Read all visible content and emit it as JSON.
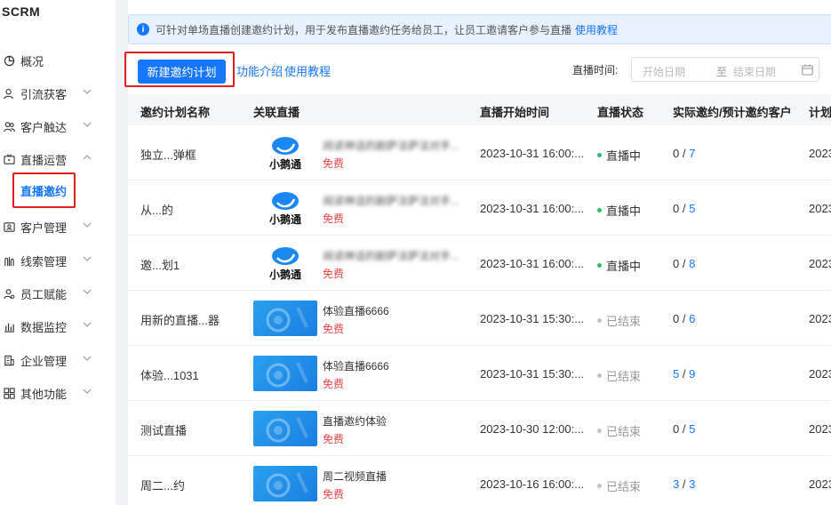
{
  "app": {
    "brand": "SCRM"
  },
  "sidebar": {
    "items": [
      {
        "label": "概况",
        "icon": "pie-chart-icon",
        "has_chevron": false
      },
      {
        "label": "引流获客",
        "icon": "user-add-icon",
        "has_chevron": true
      },
      {
        "label": "客户触达",
        "icon": "users-icon",
        "has_chevron": true
      },
      {
        "label": "直播运营",
        "icon": "tv-icon",
        "has_chevron": true,
        "expanded": true
      },
      {
        "label": "客户管理",
        "icon": "contact-card-icon",
        "has_chevron": true
      },
      {
        "label": "线索管理",
        "icon": "clue-icon",
        "has_chevron": true
      },
      {
        "label": "员工赋能",
        "icon": "staff-icon",
        "has_chevron": true
      },
      {
        "label": "数据监控",
        "icon": "bar-chart-icon",
        "has_chevron": true
      },
      {
        "label": "企业管理",
        "icon": "building-icon",
        "has_chevron": true
      },
      {
        "label": "其他功能",
        "icon": "grid-icon",
        "has_chevron": true
      }
    ],
    "active_sub": "直播邀约"
  },
  "notice": {
    "text": "可针对单场直播创建邀约计划，用于发布直播邀约任务给员工，让员工邀请客户参与直播",
    "link": "使用教程"
  },
  "toolbar": {
    "create_label": "新建邀约计划",
    "intro_label": "功能介绍",
    "tutorial_label": "使用教程",
    "time_label": "直播时间:",
    "start_placeholder": "开始日期",
    "range_sep": "至",
    "end_placeholder": "结束日期"
  },
  "table": {
    "columns": [
      "邀约计划名称",
      "关联直播",
      "直播开始时间",
      "直播状态",
      "实际邀约/预计邀约客户",
      "计划"
    ],
    "rows": [
      {
        "name": "独立...弹框",
        "live_title": "阅读神话的剧萨法萨法对手...",
        "live_thumb": "logo",
        "free": "免费",
        "start_time": "2023-10-31 16:00:...",
        "status": "直播中",
        "status_type": "live",
        "actual": "0",
        "expected": "7",
        "actual_blue": false,
        "plan": "2023"
      },
      {
        "name": "从...的",
        "live_title": "阅读神话的剧萨法萨法对手...",
        "live_thumb": "logo",
        "free": "免费",
        "start_time": "2023-10-31 16:00:...",
        "status": "直播中",
        "status_type": "live",
        "actual": "0",
        "expected": "5",
        "actual_blue": false,
        "plan": "2023"
      },
      {
        "name": "邀...划1",
        "live_title": "阅读神话的剧萨法萨法对手...",
        "live_thumb": "logo",
        "free": "免费",
        "start_time": "2023-10-31 16:00:...",
        "status": "直播中",
        "status_type": "live",
        "actual": "0",
        "expected": "8",
        "actual_blue": false,
        "plan": "2023"
      },
      {
        "name": "用新的直播...器",
        "live_title": "体验直播6666",
        "live_thumb": "blue",
        "free": "免费",
        "start_time": "2023-10-31 15:30:...",
        "status": "已结束",
        "status_type": "ended",
        "actual": "0",
        "expected": "6",
        "actual_blue": false,
        "plan": "2023"
      },
      {
        "name": "体验...1031",
        "live_title": "体验直播6666",
        "live_thumb": "blue",
        "free": "免费",
        "start_time": "2023-10-31 15:30:...",
        "status": "已结束",
        "status_type": "ended",
        "actual": "5",
        "expected": "9",
        "actual_blue": true,
        "plan": "2023"
      },
      {
        "name": "测试直播",
        "live_title": "直播邀约体验",
        "live_thumb": "blue",
        "free": "免费",
        "start_time": "2023-10-30 12:00:...",
        "status": "已结束",
        "status_type": "ended",
        "actual": "0",
        "expected": "5",
        "actual_blue": false,
        "plan": "2023"
      },
      {
        "name": "周二...约",
        "live_title": "周二视频直播",
        "live_thumb": "blue",
        "free": "免费",
        "start_time": "2023-10-16 16:00:...",
        "status": "已结束",
        "status_type": "ended",
        "actual": "3",
        "expected": "3",
        "actual_blue": true,
        "plan": "2023"
      }
    ]
  },
  "colors": {
    "accent": "#1677ff",
    "live_dot": "#2bbd6e",
    "ended_dot": "#c0c4cc",
    "free": "#e84545",
    "highlight_box": "#e02020"
  }
}
